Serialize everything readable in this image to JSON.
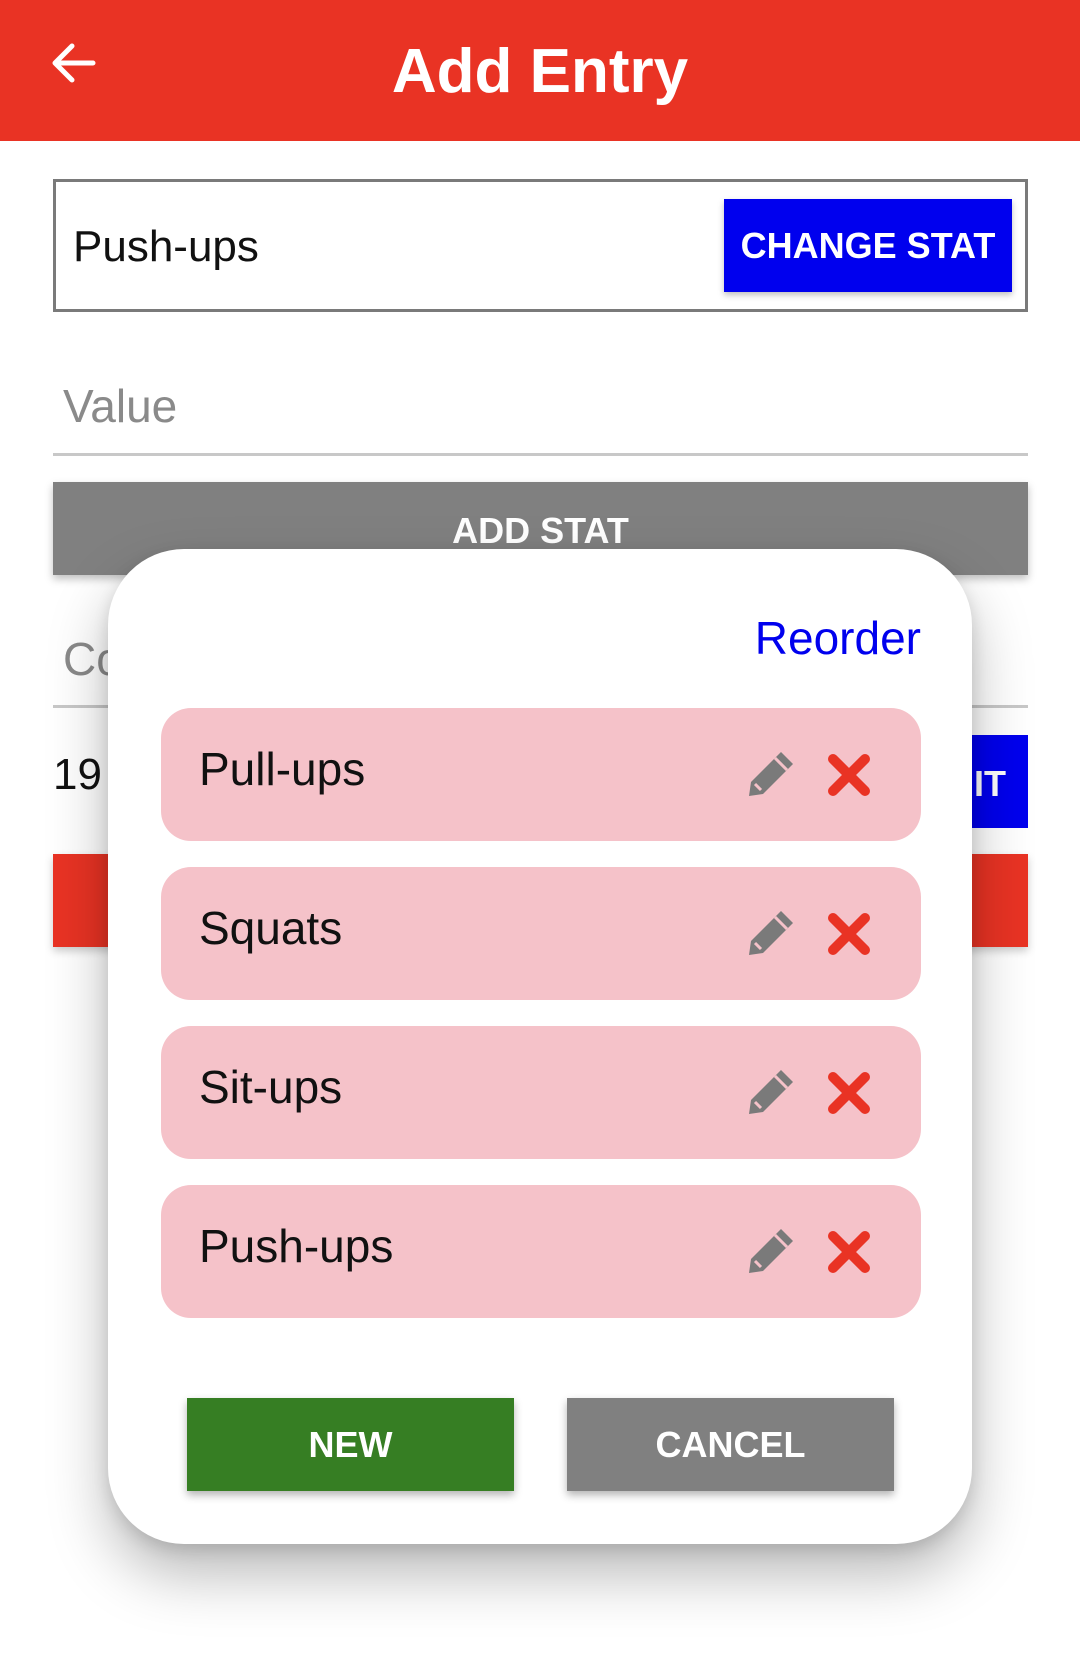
{
  "appbar": {
    "title": "Add Entry",
    "back_icon": "arrow-left-icon"
  },
  "form": {
    "selected_stat": "Push-ups",
    "change_stat_label": "CHANGE STAT",
    "value_placeholder": "Value",
    "add_stat_label": "ADD STAT",
    "comment_placeholder_visible": "Co",
    "date_visible": "19",
    "edit_button_visible": "IT"
  },
  "dialog": {
    "reorder_label": "Reorder",
    "stats": [
      {
        "label": "Pull-ups"
      },
      {
        "label": "Squats"
      },
      {
        "label": "Sit-ups"
      },
      {
        "label": "Push-ups"
      }
    ],
    "new_label": "NEW",
    "cancel_label": "CANCEL"
  },
  "colors": {
    "appbar": "#e93324",
    "primary_blue": "#0000ee",
    "item_bg": "#f5c2c9",
    "delete_red": "#e93324",
    "new_green": "#367e23",
    "neutral_gray": "#808080"
  }
}
